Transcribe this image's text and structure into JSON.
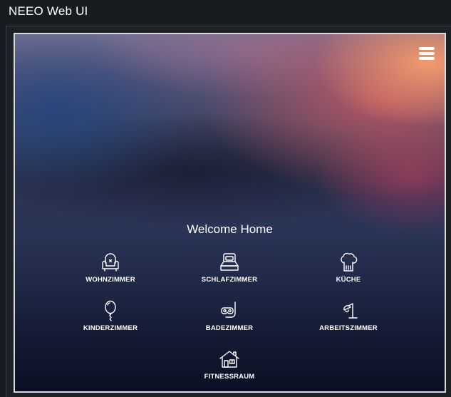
{
  "window": {
    "title": "NEEO Web UI"
  },
  "hero": {
    "welcome_text": "Welcome Home"
  },
  "menu": {
    "icon": "hamburger-menu-icon"
  },
  "rooms": [
    {
      "label": "WOHNZIMMER",
      "icon": "armchair-icon"
    },
    {
      "label": "SCHLAFZIMMER",
      "icon": "bed-icon"
    },
    {
      "label": "KÜCHE",
      "icon": "chef-hat-icon"
    },
    {
      "label": "KINDERZIMMER",
      "icon": "balloon-icon"
    },
    {
      "label": "BADEZIMMER",
      "icon": "snorkel-mask-icon"
    },
    {
      "label": "ARBEITSZIMMER",
      "icon": "desk-lamp-icon"
    },
    {
      "label": "FITNESSRAUM",
      "icon": "house-icon"
    }
  ],
  "colors": {
    "page_background": "#161c20",
    "text": "#ffffff",
    "frame_border": "#d9d9d9"
  }
}
